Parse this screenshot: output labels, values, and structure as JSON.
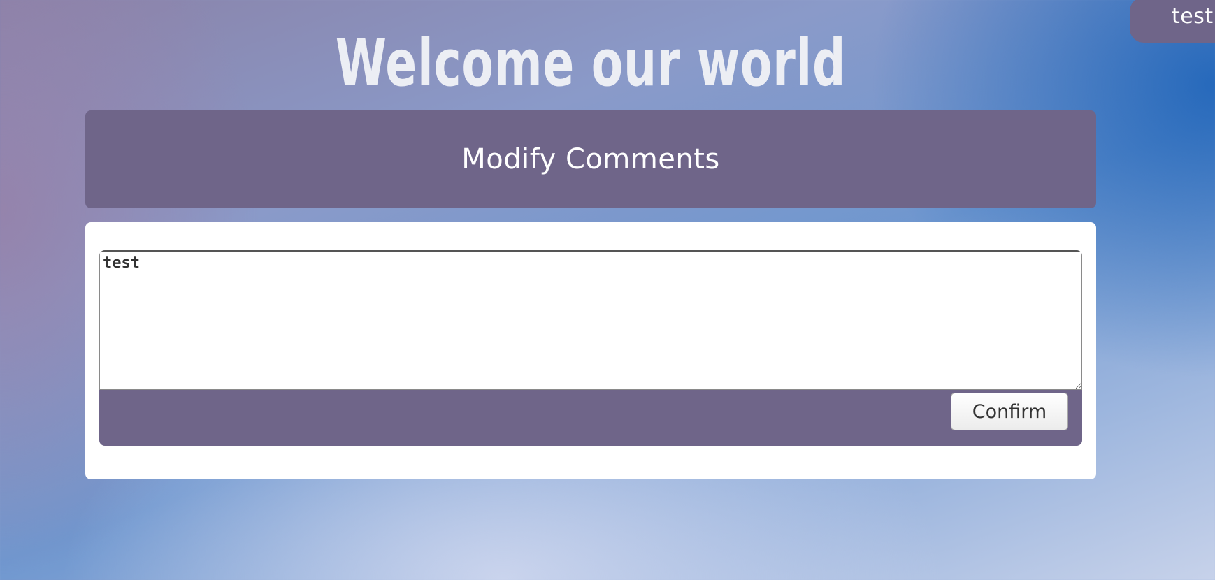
{
  "user": {
    "name": "test"
  },
  "page": {
    "title": "Welcome our world"
  },
  "header": {
    "title": "Modify Comments"
  },
  "form": {
    "comment_value": "test",
    "confirm_label": "Confirm"
  },
  "colors": {
    "accent": "#6f6589",
    "card_background": "#ffffff",
    "title_text": "#eceef4"
  }
}
